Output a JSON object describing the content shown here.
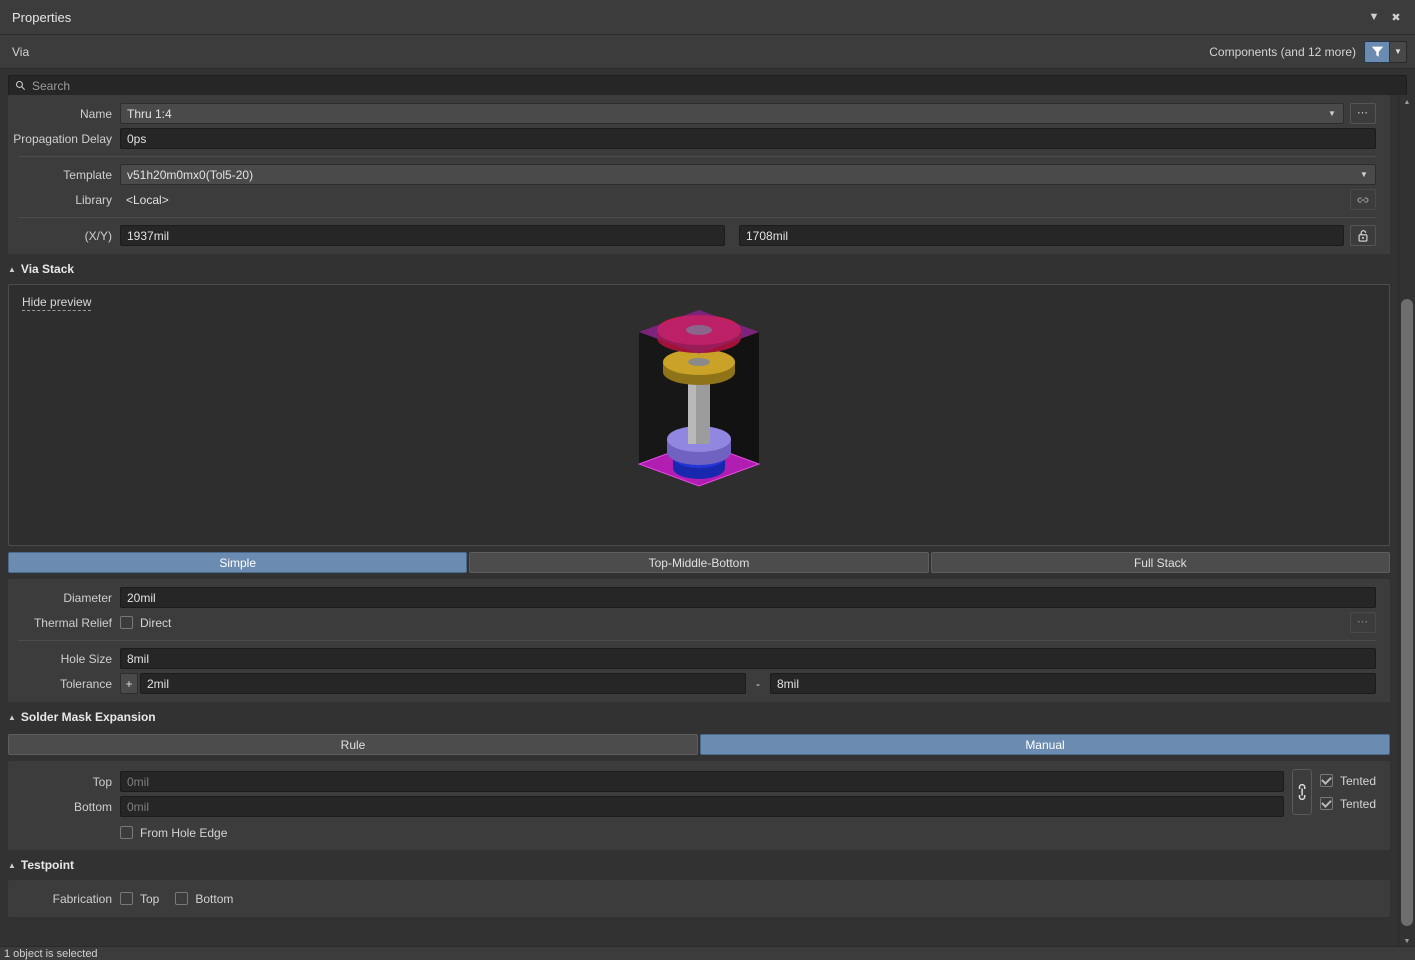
{
  "window": {
    "title": "Properties",
    "collapse_icon": "chevron-down-icon",
    "close_icon": "close-icon"
  },
  "object_row": {
    "object_type": "Via",
    "filter_scope": "Components (and 12 more)",
    "filter_icon": "funnel-icon",
    "filter_dropdown_icon": "chevron-down-icon"
  },
  "search": {
    "placeholder": "Search",
    "icon": "search-icon"
  },
  "general": {
    "name_label": "Name",
    "name_value": "Thru 1:4",
    "name_dropdown_icon": "chevron-down-icon",
    "name_more_icon": "ellipsis-icon",
    "propagation_label": "Propagation Delay",
    "propagation_value": "0ps",
    "template_label": "Template",
    "template_value": "v51h20m0mx0(Tol5-20)",
    "template_dropdown_icon": "chevron-down-icon",
    "library_label": "Library",
    "library_value": "<Local>",
    "library_link_icon": "chain-link-icon",
    "xy_label": "(X/Y)",
    "x_value": "1937mil",
    "y_value": "1708mil",
    "lock_icon": "unlocked-padlock-icon"
  },
  "via_stack": {
    "section_title": "Via Stack",
    "collapse_icon": "triangle-collapse-icon",
    "hide_preview_label": "Hide preview",
    "modes": [
      {
        "label": "Simple",
        "selected": true
      },
      {
        "label": "Top-Middle-Bottom",
        "selected": false
      },
      {
        "label": "Full Stack",
        "selected": false
      }
    ],
    "diameter_label": "Diameter",
    "diameter_value": "20mil",
    "thermal_relief_label": "Thermal Relief",
    "thermal_relief_direct_label": "Direct",
    "thermal_relief_direct_checked": false,
    "thermal_relief_more_icon": "ellipsis-icon",
    "hole_size_label": "Hole Size",
    "hole_size_value": "8mil",
    "tolerance_label": "Tolerance",
    "tolerance_plus_sign": "+",
    "tolerance_plus_value": "2mil",
    "tolerance_minus_sign": "-",
    "tolerance_minus_value": "8mil"
  },
  "preview": {
    "colors": {
      "top_plane": "#8e2a8e",
      "bottom_plane": "#c21fc2",
      "top_pad": "#d81b4e",
      "mid_pad": "#c9a227",
      "barrel": "#a8a8a8",
      "lower_pad": "#8b7ddc",
      "bottom_pad": "#1f2fc4",
      "body": "#141414"
    }
  },
  "solder_mask": {
    "section_title": "Solder Mask Expansion",
    "collapse_icon": "triangle-collapse-icon",
    "modes": [
      {
        "label": "Rule",
        "selected": false
      },
      {
        "label": "Manual",
        "selected": true
      }
    ],
    "top_label": "Top",
    "top_value": "0mil",
    "bottom_label": "Bottom",
    "bottom_value": "0mil",
    "link_icon": "chain-link-icon",
    "top_tented_label": "Tented",
    "top_tented_checked": true,
    "bottom_tented_label": "Tented",
    "bottom_tented_checked": true,
    "from_hole_edge_label": "From Hole Edge",
    "from_hole_edge_checked": false
  },
  "testpoint": {
    "section_title": "Testpoint",
    "collapse_icon": "triangle-collapse-icon",
    "fabrication_label": "Fabrication",
    "top_label": "Top",
    "top_checked": false,
    "bottom_label": "Bottom",
    "bottom_checked": false
  },
  "scrollbar": {
    "up_icon": "triangle-up-icon",
    "down_icon": "triangle-down-icon"
  },
  "status_bar": {
    "message": "1 object is selected"
  }
}
